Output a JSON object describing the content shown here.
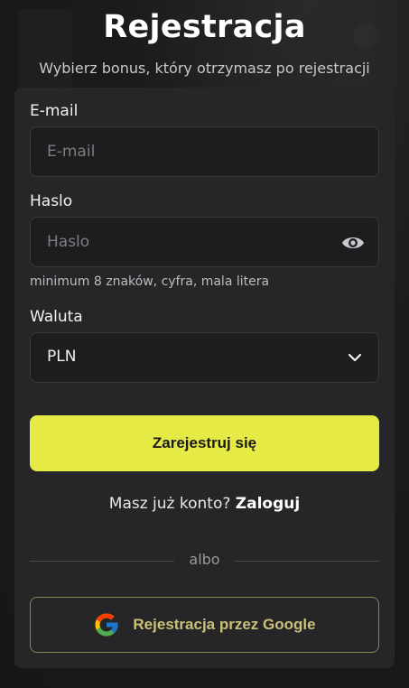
{
  "header": {
    "title": "Rejestracja",
    "subtitle": "Wybierz bonus, który otrzymasz po rejestracji"
  },
  "form": {
    "email": {
      "label": "E-mail",
      "placeholder": "E-mail",
      "value": ""
    },
    "password": {
      "label": "Haslo",
      "placeholder": "Haslo",
      "value": "",
      "hint": "minimum 8 znaków, cyfra, mala litera",
      "toggle_icon": "eye-icon"
    },
    "currency": {
      "label": "Waluta",
      "selected": "PLN",
      "icon": "chevron-down-icon"
    },
    "submit_label": "Zarejestruj się"
  },
  "login": {
    "prompt": "Masz już konto?",
    "link": "Zaloguj"
  },
  "divider_text": "albo",
  "google": {
    "label": "Rejestracja przez Google",
    "icon": "google-icon"
  },
  "colors": {
    "accent": "#e6ea45",
    "card": "#262628",
    "field": "#1d1d1f",
    "google_border": "#8b844e",
    "google_text": "#c9c07a"
  }
}
